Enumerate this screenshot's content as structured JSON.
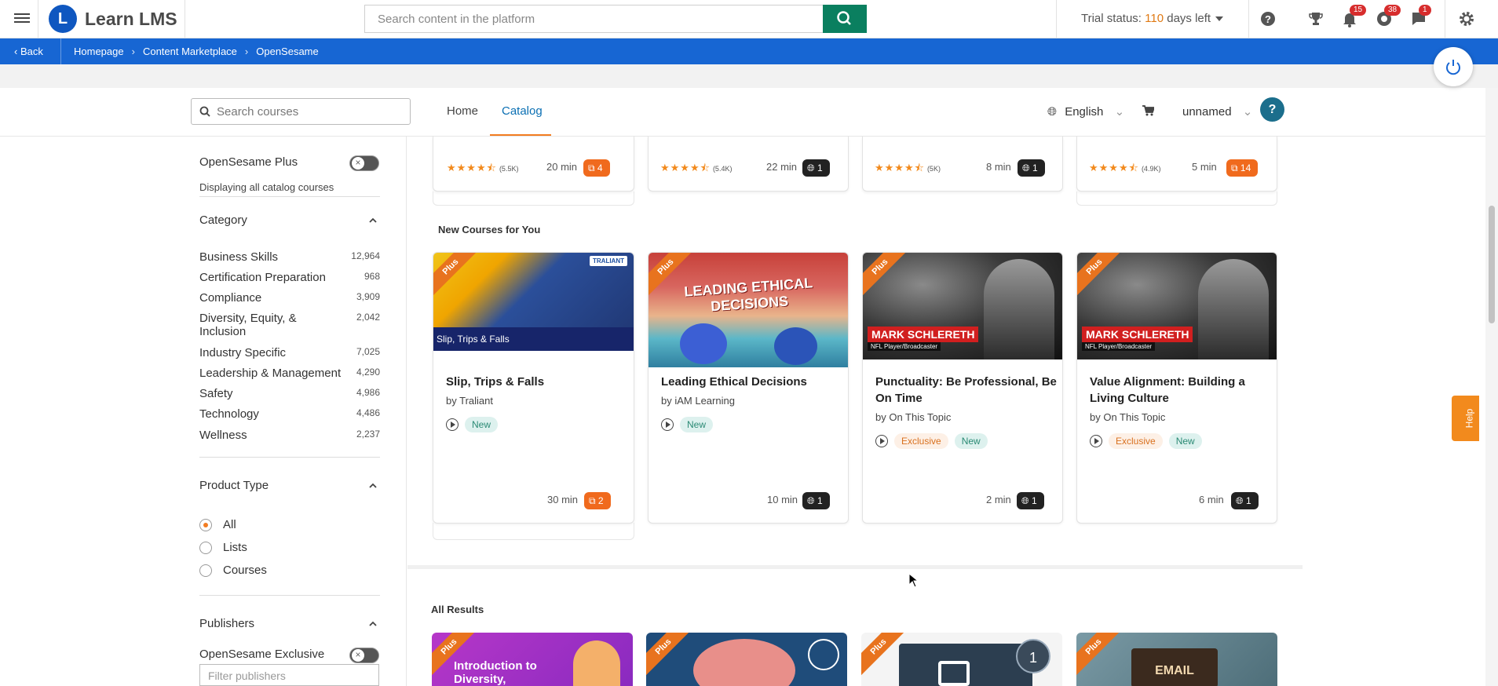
{
  "header": {
    "app_name": "Learn LMS",
    "search_placeholder": "Search content in the platform",
    "trial_prefix": "Trial status: ",
    "trial_days": "110",
    "trial_suffix": " days left",
    "badges": {
      "notifications": "15",
      "messages": "38",
      "chat": "1"
    }
  },
  "breadcrumb": {
    "back": "Back",
    "items": [
      "Homepage",
      "Content Marketplace",
      "OpenSesame"
    ]
  },
  "navbar": {
    "search_placeholder": "Search courses",
    "tabs": [
      "Home",
      "Catalog"
    ],
    "language": "English",
    "user": "unnamed",
    "help": "?"
  },
  "sidebar": {
    "plus_label": "OpenSesame Plus",
    "displaying": "Displaying all catalog courses",
    "category_title": "Category",
    "categories": [
      {
        "name": "Business Skills",
        "count": "12,964"
      },
      {
        "name": "Certification Preparation",
        "count": "968"
      },
      {
        "name": "Compliance",
        "count": "3,909"
      },
      {
        "name": "Diversity, Equity, & Inclusion",
        "count": "2,042"
      },
      {
        "name": "Industry Specific",
        "count": "7,025"
      },
      {
        "name": "Leadership & Management",
        "count": "4,290"
      },
      {
        "name": "Safety",
        "count": "4,986"
      },
      {
        "name": "Technology",
        "count": "4,486"
      },
      {
        "name": "Wellness",
        "count": "2,237"
      }
    ],
    "product_type_title": "Product Type",
    "product_types": [
      "All",
      "Lists",
      "Courses"
    ],
    "publishers_title": "Publishers",
    "exclusive_label": "OpenSesame Exclusive",
    "filter_placeholder": "Filter publishers"
  },
  "top_row": [
    {
      "reviews": "(5.5K)",
      "duration": "20 min",
      "count": "4",
      "pill": "orange"
    },
    {
      "reviews": "(5.4K)",
      "duration": "22 min",
      "count": "1",
      "pill": "dark"
    },
    {
      "reviews": "(5K)",
      "duration": "8 min",
      "count": "1",
      "pill": "dark"
    },
    {
      "reviews": "(4.9K)",
      "duration": "5 min",
      "count": "14",
      "pill": "orange"
    }
  ],
  "new_courses": {
    "title": "New Courses for You",
    "plus_ribbon": "Plus",
    "cards": [
      {
        "title": "Slip, Trips & Falls",
        "author": "by Traliant",
        "tags": [
          "New"
        ],
        "duration": "30 min",
        "count": "2",
        "pill": "orange",
        "thumb_caption": "Slip, Trips & Falls",
        "thumb_logo": "TRALIANT"
      },
      {
        "title": "Leading Ethical Decisions",
        "author": "by iAM Learning",
        "tags": [
          "New"
        ],
        "duration": "10 min",
        "count": "1",
        "pill": "dark",
        "thumb_caption": "LEADING ETHICAL DECISIONS"
      },
      {
        "title": "Punctuality: Be Professional, Be On Time",
        "author": "by On This Topic",
        "tags": [
          "Exclusive",
          "New"
        ],
        "duration": "2 min",
        "count": "1",
        "pill": "dark",
        "thumb_caption": "MARK SCHLERETH",
        "thumb_sub": "NFL Player/Broadcaster"
      },
      {
        "title": "Value Alignment: Building a Living Culture",
        "author": "by On This Topic",
        "tags": [
          "Exclusive",
          "New"
        ],
        "duration": "6 min",
        "count": "1",
        "pill": "dark",
        "thumb_caption": "MARK SCHLERETH",
        "thumb_sub": "NFL Player/Broadcaster"
      }
    ]
  },
  "all_results": {
    "title": "All Results",
    "thumbs": [
      "Introduction to Diversity,",
      "",
      "1",
      "EMAIL"
    ]
  },
  "help_tab": "Help",
  "colors": {
    "brand_blue": "#1766d3",
    "accent_orange": "#f27c21",
    "search_green": "#0a7f5f"
  }
}
